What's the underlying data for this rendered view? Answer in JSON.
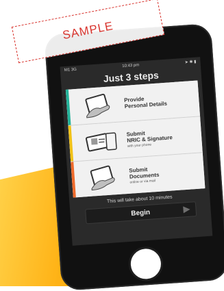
{
  "stamp": {
    "text": "SAMPLE"
  },
  "status_bar": {
    "carrier": "M1 3G",
    "time": "10:43 pm",
    "icons": [
      "location-icon",
      "bluetooth-icon",
      "battery-icon"
    ]
  },
  "title": "Just 3 steps",
  "steps": [
    {
      "title_line1": "Provide",
      "title_line2": "Personal Details",
      "subtitle": "",
      "accent": "#24b39a",
      "icon": "hand-tablet-icon"
    },
    {
      "title_line1": "Submit",
      "title_line2": "NRIC & Signature",
      "subtitle": "with your phone",
      "accent": "#f1c217",
      "icon": "hand-card-icon"
    },
    {
      "title_line1": "Submit",
      "title_line2": "Documents",
      "subtitle": "online or via mail",
      "accent": "#ef6b2c",
      "icon": "hand-document-icon"
    }
  ],
  "footer": "This will take about 10 minutes",
  "begin_label": "Begin"
}
